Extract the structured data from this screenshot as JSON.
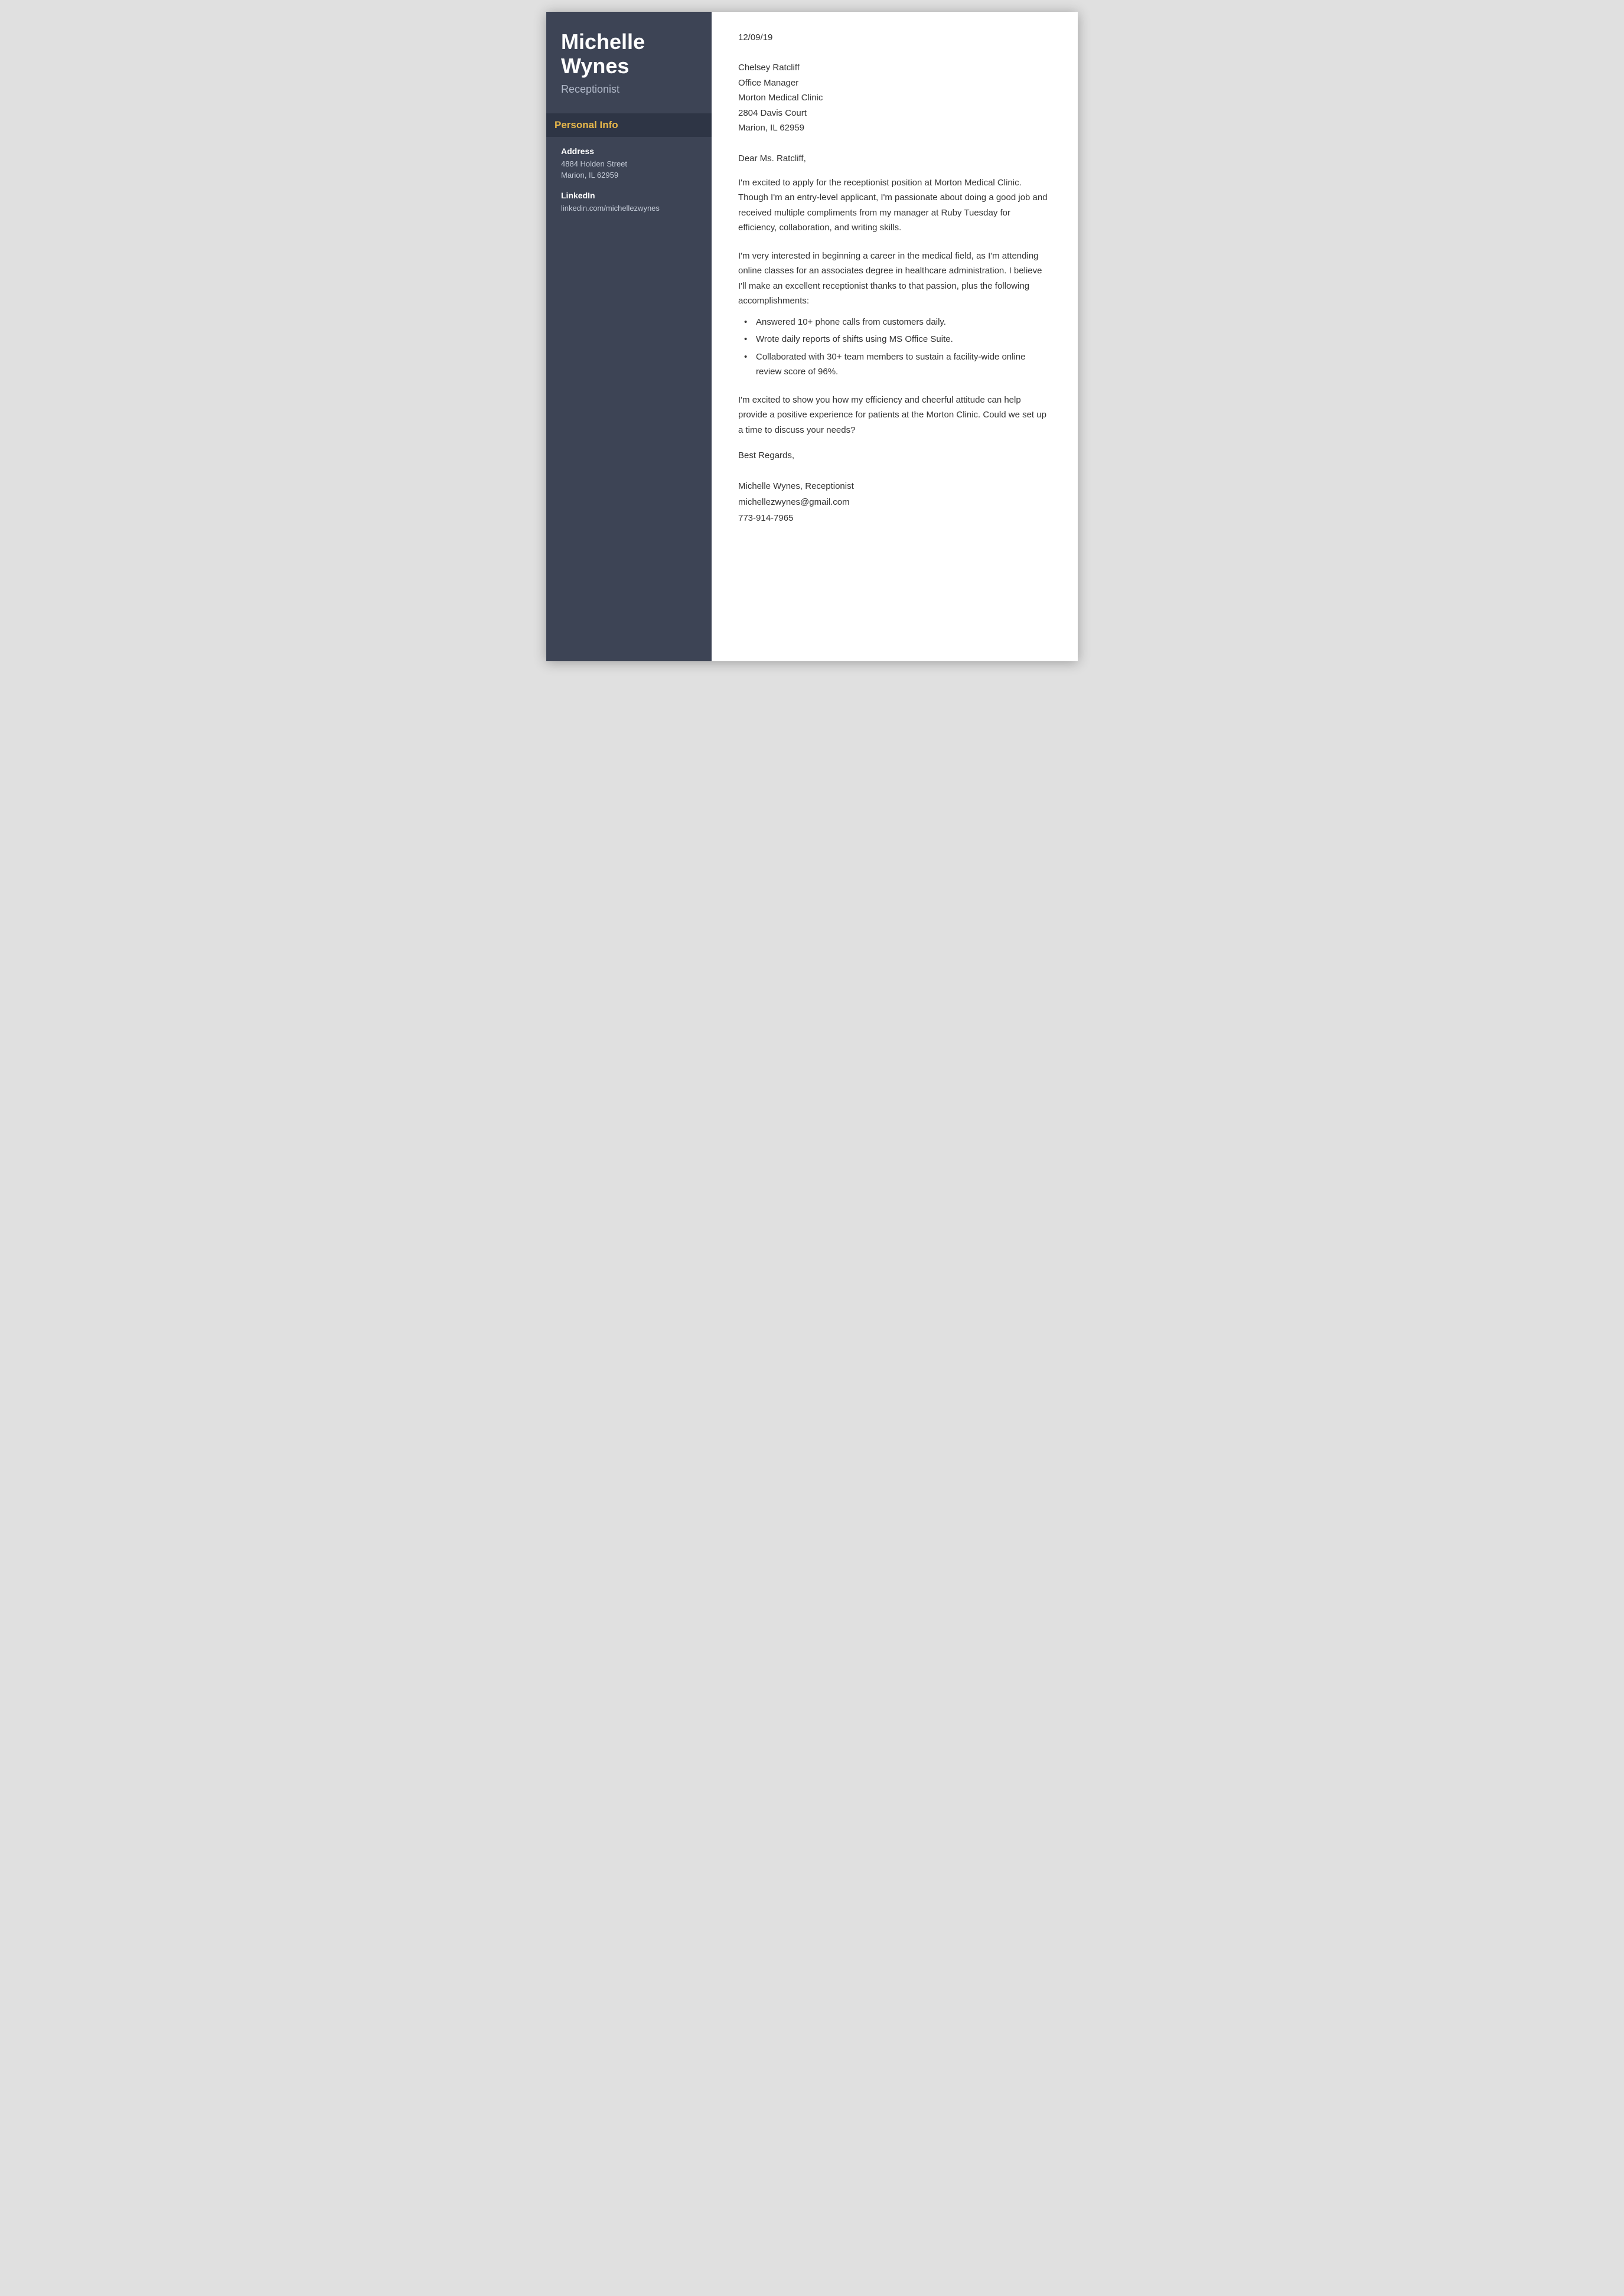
{
  "sidebar": {
    "name_line1": "Michelle",
    "name_line2": "Wynes",
    "job_title": "Receptionist",
    "personal_info_header": "Personal Info",
    "address_label": "Address",
    "address_line1": "4884 Holden Street",
    "address_line2": "Marion, IL 62959",
    "linkedin_label": "LinkedIn",
    "linkedin_value": "linkedin.com/michellezwynes"
  },
  "main": {
    "date": "12/09/19",
    "recipient": {
      "name": "Chelsey Ratcliff",
      "title": "Office Manager",
      "company": "Morton Medical Clinic",
      "address1": "2804 Davis Court",
      "address2": "Marion, IL 62959"
    },
    "greeting": "Dear Ms. Ratcliff,",
    "paragraph1": "I'm excited to apply for the receptionist position at Morton Medical Clinic. Though I'm an entry-level applicant, I'm passionate about doing a good job and received multiple compliments from my manager at Ruby Tuesday for efficiency, collaboration, and writing skills.",
    "paragraph2_intro": "I'm very interested in beginning a career in the medical field, as I'm attending online classes for an associates degree in healthcare administration. I believe I'll make an excellent receptionist thanks to that passion, plus the following accomplishments:",
    "bullet_items": [
      "Answered 10+ phone calls from customers daily.",
      "Wrote daily reports of shifts using MS Office Suite.",
      "Collaborated with 30+ team members to sustain a facility-wide online review score of 96%."
    ],
    "paragraph3": "I'm excited to show you how my efficiency and cheerful attitude can help provide a positive experience for patients at the Morton Clinic. Could we set up a time to discuss your needs?",
    "closing": "Best Regards,",
    "sig_name": "Michelle Wynes, Receptionist",
    "sig_email": "michellezwynes@gmail.com",
    "sig_phone": "773-914-7965"
  }
}
